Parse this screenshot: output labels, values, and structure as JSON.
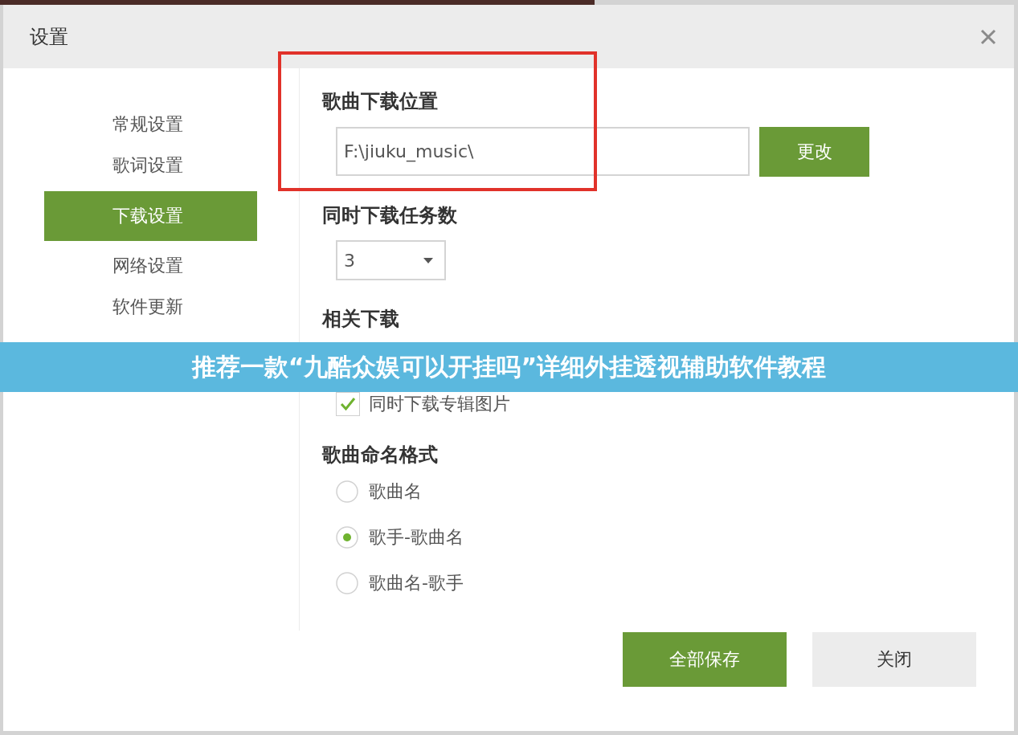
{
  "window": {
    "title": "设置"
  },
  "sidebar": {
    "items": [
      {
        "label": "常规设置",
        "selected": false
      },
      {
        "label": "歌词设置",
        "selected": false
      },
      {
        "label": "下载设置",
        "selected": true
      },
      {
        "label": "网络设置",
        "selected": false
      },
      {
        "label": "软件更新",
        "selected": false
      }
    ]
  },
  "sections": [
    {
      "kind": "path",
      "heading": "歌曲下载位置",
      "value": "F:\\jiuku_music\\",
      "button": "更改",
      "highlighted": true
    },
    {
      "kind": "select",
      "heading": "同时下载任务数",
      "value": "3"
    },
    {
      "kind": "checkboxes",
      "heading": "相关下载",
      "items": [
        {
          "label": "同时下载专辑图片",
          "checked": true
        }
      ]
    },
    {
      "kind": "radios",
      "heading": "歌曲命名格式",
      "items": [
        {
          "label": "歌曲名",
          "selected": false
        },
        {
          "label": "歌手-歌曲名",
          "selected": true
        },
        {
          "label": "歌曲名-歌手",
          "selected": false
        }
      ]
    }
  ],
  "buttons": [
    {
      "label": "全部保存",
      "kind": "primary"
    },
    {
      "label": "关闭",
      "kind": "secondary"
    }
  ],
  "overlay_banner": {
    "text": "推荐一款“九酷众娱可以开挂吗”详细外挂透视辅助软件教程"
  }
}
